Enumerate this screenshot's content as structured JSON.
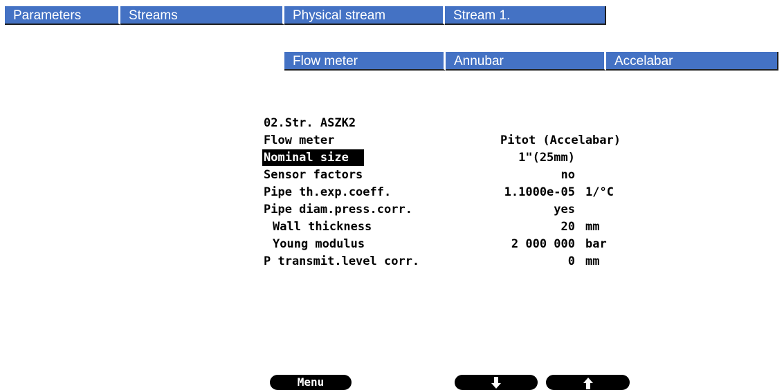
{
  "breadcrumb_top": [
    "Parameters",
    "Streams",
    "Physical stream",
    "Stream 1."
  ],
  "breadcrumb_sub": [
    "Flow meter",
    "Annubar",
    "Accelabar"
  ],
  "screen": {
    "title": "02.Str. ASZK2",
    "rows": [
      {
        "label": "Flow meter",
        "value": "Pitot (Accelabar)",
        "unit": ""
      },
      {
        "label": "Nominal size",
        "value": "1\"(25mm)",
        "unit": ""
      },
      {
        "label": "Sensor factors",
        "value": "no",
        "unit": ""
      },
      {
        "label": "Pipe th.exp.coeff.",
        "value": "1.1000e-05",
        "unit": "1/°C"
      },
      {
        "label": "Pipe diam.press.corr.",
        "value": "yes",
        "unit": ""
      },
      {
        "label": "Wall thickness",
        "value": "20",
        "unit": "mm"
      },
      {
        "label": "Young modulus",
        "value": "2 000 000",
        "unit": "bar"
      },
      {
        "label": "P transmit.level corr.",
        "value": "0",
        "unit": "mm"
      }
    ]
  },
  "softkeys": {
    "menu": "Menu",
    "down_icon": "arrow-down-icon",
    "up_icon": "arrow-up-icon"
  },
  "colors": {
    "breadcrumb_bg": "#4472c4",
    "screen_fg": "#000000"
  }
}
